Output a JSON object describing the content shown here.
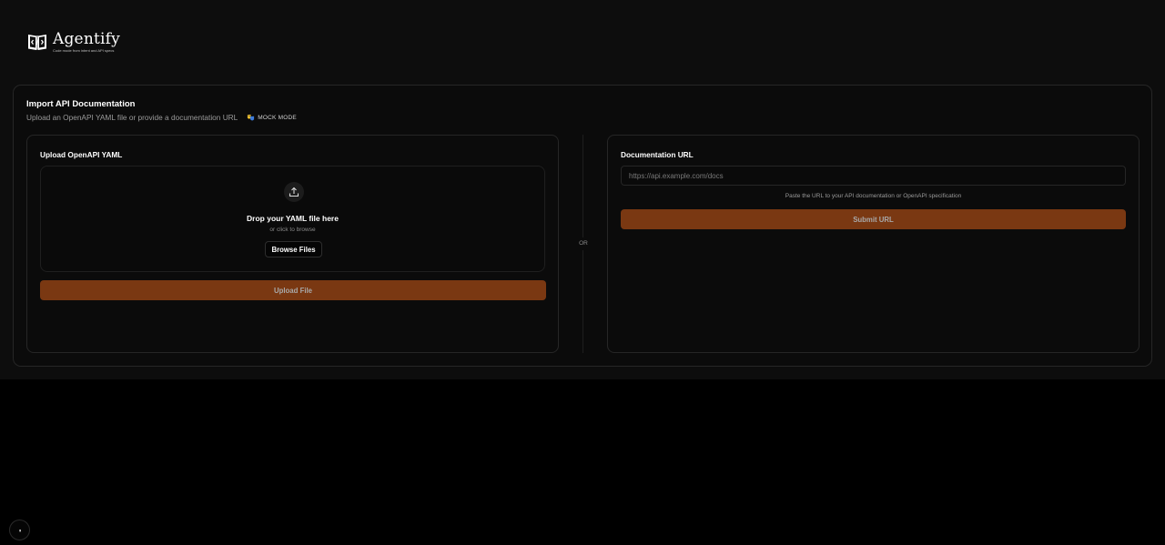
{
  "brand": {
    "name": "Agentify",
    "tagline": "Code mode from intent and API specs",
    "icon": "book-code-icon"
  },
  "import": {
    "title": "Import API Documentation",
    "description": "Upload an OpenAPI YAML file or provide a documentation URL",
    "mock_badge": "MOCK MODE"
  },
  "upload_panel": {
    "label": "Upload OpenAPI YAML",
    "drop_title": "Drop your YAML file here",
    "drop_subtitle": "or click to browse",
    "browse_label": "Browse Files",
    "upload_label": "Upload File"
  },
  "divider": {
    "label": "OR"
  },
  "url_panel": {
    "label": "Documentation URL",
    "placeholder": "https://api.example.com/docs",
    "value": "",
    "hint": "Paste the URL to your API documentation or OpenAPI specification",
    "submit_label": "Submit URL"
  },
  "colors": {
    "accent": "#7a3812",
    "background": "#0d0d0d",
    "card_border": "#262626"
  }
}
